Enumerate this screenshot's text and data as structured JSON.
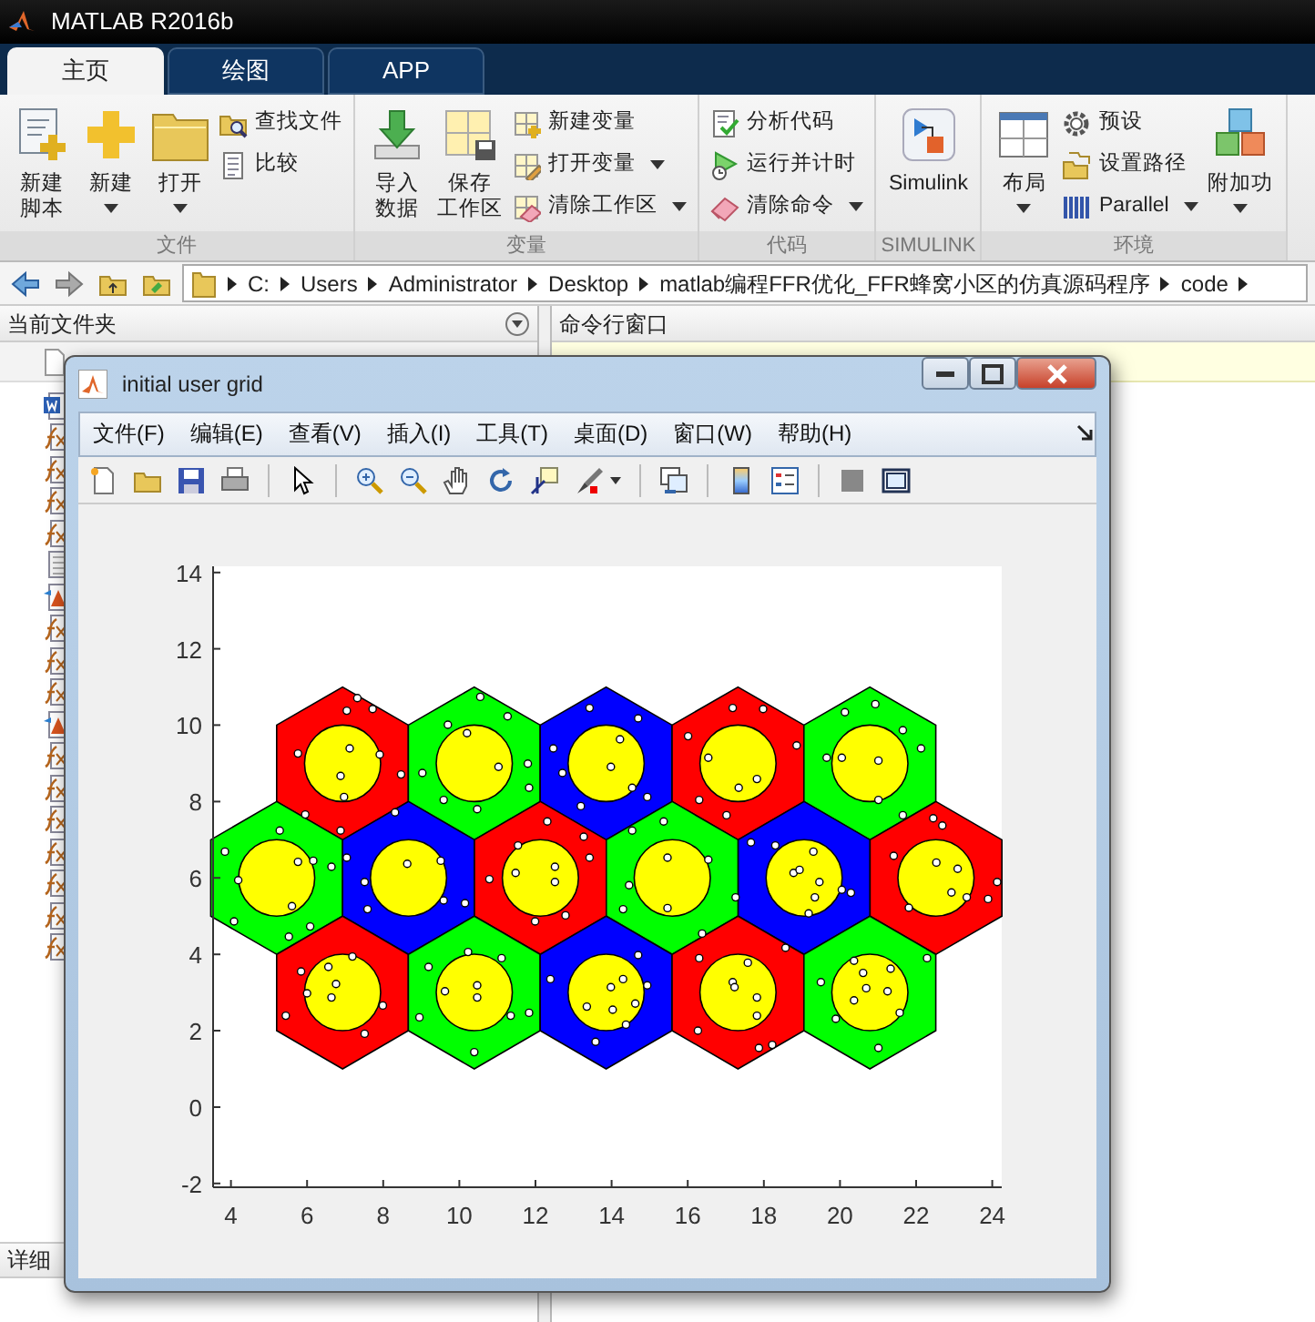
{
  "window": {
    "title": "MATLAB R2016b"
  },
  "tabs": [
    {
      "label": "主页",
      "selected": true
    },
    {
      "label": "绘图",
      "selected": false
    },
    {
      "label": "APP",
      "selected": false
    }
  ],
  "toolstrip": [
    {
      "label": "文件",
      "columns": [
        {
          "kind": "large",
          "items": [
            {
              "kind": "new-script",
              "lines": [
                "新建",
                "脚本"
              ],
              "dropdown": false
            }
          ]
        },
        {
          "kind": "large",
          "items": [
            {
              "kind": "new-plus",
              "lines": [
                "新建"
              ],
              "dropdown": true
            }
          ]
        },
        {
          "kind": "large",
          "items": [
            {
              "kind": "open-folder",
              "lines": [
                "打开"
              ],
              "dropdown": true
            }
          ]
        },
        {
          "kind": "small",
          "items": [
            {
              "kind": "find-files",
              "lines": [
                "查找文件"
              ],
              "dropdown": false
            },
            {
              "kind": "compare",
              "lines": [
                "比较"
              ],
              "dropdown": false
            }
          ]
        }
      ]
    },
    {
      "label": "变量",
      "columns": [
        {
          "kind": "large",
          "items": [
            {
              "kind": "import",
              "lines": [
                "导入",
                "数据"
              ],
              "dropdown": false
            }
          ]
        },
        {
          "kind": "large",
          "items": [
            {
              "kind": "save-workspace",
              "lines": [
                "保存",
                "工作区"
              ],
              "dropdown": false
            }
          ]
        },
        {
          "kind": "small",
          "items": [
            {
              "kind": "new-variable",
              "lines": [
                "新建变量"
              ],
              "dropdown": false
            },
            {
              "kind": "open-variable",
              "lines": [
                "打开变量"
              ],
              "dropdown": true
            },
            {
              "kind": "clear-workspace",
              "lines": [
                "清除工作区"
              ],
              "dropdown": true
            }
          ]
        }
      ]
    },
    {
      "label": "代码",
      "columns": [
        {
          "kind": "small",
          "items": [
            {
              "kind": "analyze-code",
              "lines": [
                "分析代码"
              ],
              "dropdown": false
            },
            {
              "kind": "run-time",
              "lines": [
                "运行并计时"
              ],
              "dropdown": false
            },
            {
              "kind": "clear-commands",
              "lines": [
                "清除命令"
              ],
              "dropdown": true
            }
          ]
        }
      ]
    },
    {
      "label": "SIMULINK",
      "columns": [
        {
          "kind": "large",
          "items": [
            {
              "kind": "simulink",
              "lines": [
                "Simulink"
              ],
              "dropdown": false
            }
          ]
        }
      ]
    },
    {
      "label": "环境",
      "columns": [
        {
          "kind": "large",
          "items": [
            {
              "kind": "layout",
              "lines": [
                "布局"
              ],
              "dropdown": true
            }
          ]
        },
        {
          "kind": "small",
          "items": [
            {
              "kind": "preferences",
              "lines": [
                "预设"
              ],
              "dropdown": false
            },
            {
              "kind": "set-path",
              "lines": [
                "设置路径"
              ],
              "dropdown": false
            },
            {
              "kind": "parallel",
              "lines": [
                "Parallel"
              ],
              "dropdown": true
            }
          ]
        },
        {
          "kind": "large",
          "items": [
            {
              "kind": "addons",
              "lines": [
                "附加功"
              ],
              "dropdown": true
            }
          ]
        }
      ]
    }
  ],
  "address_bar": {
    "path": [
      "C:",
      "Users",
      "Administrator",
      "Desktop",
      "matlab编程FFR优化_FFR蜂窝小区的仿真源码程序",
      "code"
    ]
  },
  "current_folder": {
    "title": "当前文件夹",
    "files": [
      {
        "kind": "word"
      },
      {
        "kind": "function"
      },
      {
        "kind": "function"
      },
      {
        "kind": "function"
      },
      {
        "kind": "function"
      },
      {
        "kind": "text"
      },
      {
        "kind": "figure"
      },
      {
        "kind": "function"
      },
      {
        "kind": "function"
      },
      {
        "kind": "function"
      },
      {
        "kind": "figure"
      },
      {
        "kind": "function"
      },
      {
        "kind": "function"
      },
      {
        "kind": "function"
      },
      {
        "kind": "function"
      },
      {
        "kind": "function"
      },
      {
        "kind": "function"
      },
      {
        "kind": "function"
      }
    ],
    "details_title": "详细"
  },
  "command_window": {
    "title": "命令行窗口"
  },
  "figure": {
    "title": "initial user grid",
    "menu": [
      "文件(F)",
      "编辑(E)",
      "查看(V)",
      "插入(I)",
      "工具(T)",
      "桌面(D)",
      "窗口(W)",
      "帮助(H)"
    ],
    "toolbar": [
      {
        "kind": "new"
      },
      {
        "kind": "open"
      },
      {
        "kind": "save"
      },
      {
        "kind": "print"
      },
      {
        "kind": "separator"
      },
      {
        "kind": "pointer"
      },
      {
        "kind": "separator"
      },
      {
        "kind": "zoom-in"
      },
      {
        "kind": "zoom-out"
      },
      {
        "kind": "pan"
      },
      {
        "kind": "rotate"
      },
      {
        "kind": "data-cursor"
      },
      {
        "kind": "brush"
      },
      {
        "kind": "separator"
      },
      {
        "kind": "link"
      },
      {
        "kind": "separator"
      },
      {
        "kind": "colorbar"
      },
      {
        "kind": "legend"
      },
      {
        "kind": "separator"
      },
      {
        "kind": "hide-tools"
      },
      {
        "kind": "show-tools"
      }
    ],
    "axes": {
      "cells": [
        {
          "color": "#ff0000"
        },
        {
          "color": "#00ff00"
        },
        {
          "color": "#0000ff"
        },
        {
          "color": "#ff0000"
        },
        {
          "color": "#00ff00"
        },
        {
          "color": "#00ff00"
        },
        {
          "color": "#0000ff"
        },
        {
          "color": "#ff0000"
        },
        {
          "color": "#00ff00"
        },
        {
          "color": "#0000ff"
        },
        {
          "color": "#ff0000"
        },
        {
          "color": "#ff0000"
        },
        {
          "color": "#00ff00"
        },
        {
          "color": "#0000ff"
        },
        {
          "color": "#ff0000"
        },
        {
          "color": "#00ff00"
        }
      ],
      "chart_data": {
        "type": "scatter",
        "xlim": [
          3.53,
          24.25
        ],
        "ylim": [
          -2.1,
          14.16
        ],
        "xticks": [
          4,
          6,
          8,
          10,
          12,
          14,
          16,
          18,
          20,
          22,
          24
        ],
        "yticks": [
          -2,
          0,
          2,
          4,
          6,
          8,
          10,
          12,
          14
        ],
        "x": [
          5.76,
          7.04,
          7.32,
          7.72,
          7.91,
          8.47,
          6.97,
          5.95,
          7.12,
          6.88,
          9.03,
          9.7,
          10.55,
          11.27,
          11.8,
          11.83,
          9.59,
          10.47,
          11.03,
          10.2,
          12.47,
          13.42,
          14.7,
          14.22,
          13.98,
          14.54,
          14.94,
          13.19,
          12.71,
          16.01,
          16.54,
          17.18,
          17.98,
          18.86,
          17.82,
          17.34,
          16.3,
          17.02,
          19.65,
          20.05,
          20.13,
          20.93,
          21.01,
          21.65,
          22.13,
          21.01,
          21.65,
          3.84,
          4.19,
          5.28,
          5.76,
          6.16,
          6.64,
          5.6,
          6.08,
          4.08,
          5.52,
          7.04,
          7.51,
          8.63,
          9.51,
          9.59,
          10.15,
          8.31,
          7.59,
          6.88,
          10.79,
          11.48,
          11.54,
          12.51,
          12.51,
          13.42,
          11.99,
          12.79,
          13.27,
          12.31,
          14.46,
          14.3,
          14.54,
          15.47,
          15.47,
          16.54,
          16.38,
          17.26,
          15.37,
          18.3,
          18.78,
          18.94,
          19.3,
          19.46,
          19.34,
          19.18,
          20.05,
          20.29,
          17.66,
          21.41,
          21.81,
          22.53,
          23.09,
          22.93,
          23.33,
          23.89,
          24.13,
          22.45,
          22.69,
          6.0,
          6.56,
          6.76,
          6.64,
          7.19,
          7.99,
          7.51,
          5.44,
          5.84,
          9.19,
          9.62,
          10.23,
          10.47,
          10.47,
          11.11,
          11.35,
          11.83,
          8.95,
          10.39,
          12.39,
          13.35,
          13.98,
          14.03,
          14.3,
          14.62,
          14.7,
          13.58,
          14.38,
          14.94,
          16.3,
          17.18,
          17.23,
          17.58,
          17.82,
          17.82,
          17.87,
          18.22,
          18.57,
          16.27,
          19.5,
          19.89,
          20.37,
          20.37,
          20.61,
          20.69,
          21.25,
          21.33,
          21.57,
          22.29,
          21.01
        ],
        "series": [
          {
            "color": "#ffffff",
            "values": [
              9.26,
              10.38,
              10.71,
              10.42,
              9.23,
              8.71,
              8.12,
              7.66,
              9.39,
              8.67,
              8.75,
              10.01,
              10.74,
              10.23,
              8.99,
              8.36,
              8.04,
              7.8,
              8.91,
              9.79,
              9.39,
              10.45,
              10.18,
              9.63,
              8.91,
              8.36,
              8.12,
              7.88,
              8.75,
              9.71,
              9.15,
              10.45,
              10.42,
              9.47,
              8.59,
              8.36,
              8.04,
              7.64,
              9.15,
              9.15,
              10.34,
              10.55,
              9.07,
              9.87,
              9.39,
              8.04,
              7.64,
              6.69,
              5.94,
              7.24,
              6.42,
              6.45,
              6.29,
              5.26,
              4.73,
              4.86,
              4.46,
              6.53,
              5.89,
              6.37,
              6.45,
              5.41,
              5.34,
              7.72,
              5.18,
              7.24,
              5.97,
              6.13,
              6.85,
              6.29,
              5.89,
              6.53,
              4.86,
              5.02,
              7.08,
              7.48,
              5.81,
              5.18,
              7.24,
              6.53,
              5.21,
              6.48,
              4.54,
              5.49,
              7.48,
              6.85,
              6.13,
              6.21,
              6.69,
              5.89,
              5.49,
              5.07,
              5.69,
              5.61,
              6.93,
              6.58,
              5.22,
              6.4,
              6.24,
              5.62,
              5.49,
              5.45,
              5.89,
              7.56,
              7.37,
              2.98,
              3.67,
              3.22,
              2.87,
              3.94,
              2.66,
              1.92,
              2.39,
              3.55,
              3.67,
              3.03,
              4.06,
              3.19,
              2.87,
              3.9,
              2.39,
              2.47,
              2.35,
              1.44,
              3.35,
              2.63,
              3.14,
              2.55,
              3.35,
              2.71,
              3.98,
              1.71,
              2.16,
              3.19,
              3.9,
              3.27,
              3.14,
              3.78,
              2.87,
              2.39,
              1.55,
              1.63,
              4.17,
              2.0,
              3.27,
              2.31,
              3.83,
              2.79,
              3.51,
              3.11,
              3.03,
              3.62,
              2.47,
              3.9,
              1.55
            ]
          }
        ]
      }
    }
  }
}
